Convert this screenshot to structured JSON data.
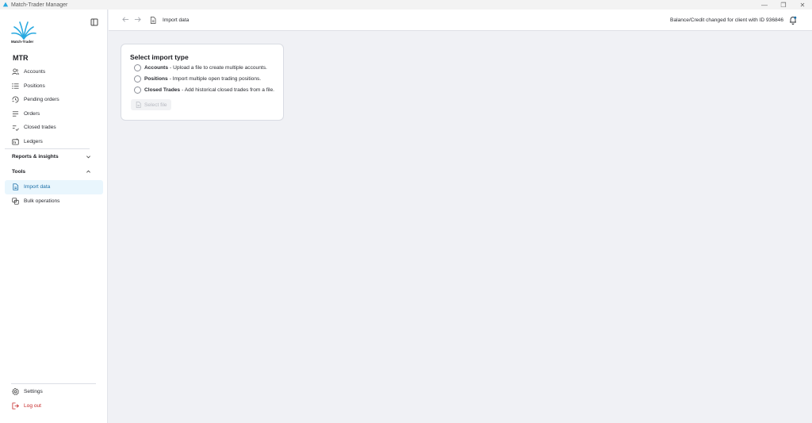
{
  "window": {
    "title": "Match-Trader Manager",
    "controls": {
      "minimize": "—",
      "restore": "❐",
      "close": "✕"
    }
  },
  "sidebar": {
    "logo_text": "Match-Trader",
    "brand": "MTR",
    "items": [
      {
        "label": "Accounts",
        "icon": "users-icon"
      },
      {
        "label": "Positions",
        "icon": "list-icon"
      },
      {
        "label": "Pending orders",
        "icon": "pending-icon"
      },
      {
        "label": "Orders",
        "icon": "lines-icon"
      },
      {
        "label": "Closed trades",
        "icon": "closed-trades-icon"
      },
      {
        "label": "Ledgers",
        "icon": "ledger-icon"
      }
    ],
    "sections": {
      "reports": "Reports & insights",
      "tools": "Tools"
    },
    "tools_items": [
      {
        "label": "Import data",
        "icon": "file-import-icon",
        "active": true
      },
      {
        "label": "Bulk operations",
        "icon": "copy-icon"
      }
    ],
    "bottom": {
      "settings": "Settings",
      "logout": "Log out"
    }
  },
  "header": {
    "breadcrumb": "Import data",
    "notice": "Balance/Credit changed for client with ID 936846"
  },
  "card": {
    "title": "Select import type",
    "options": [
      {
        "name": "Accounts",
        "desc": "- Upload a file to create multiple accounts."
      },
      {
        "name": "Positions",
        "desc": "- Import multiple open trading positions."
      },
      {
        "name": "Closed Trades",
        "desc": "- Add historical closed trades from a file."
      }
    ],
    "select_file_label": "Select file"
  },
  "colors": {
    "accent": "#1b6fa8",
    "active_bg": "#e9f6fd",
    "logout": "#c62828",
    "logo": "#29a9e0"
  }
}
